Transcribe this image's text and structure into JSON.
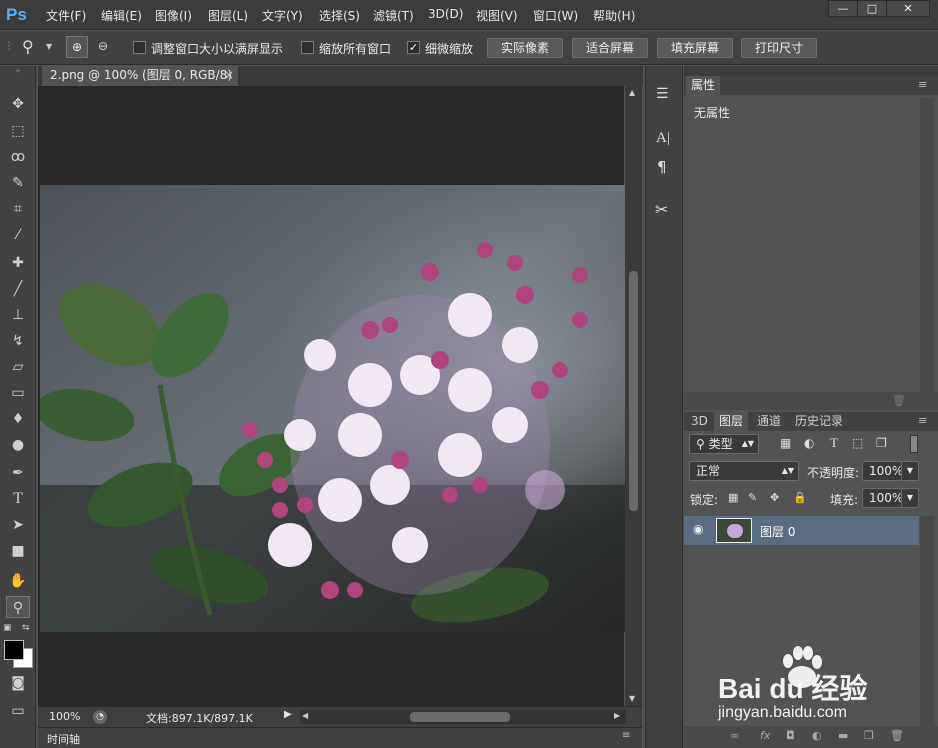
{
  "app": {
    "logo": "Ps"
  },
  "menu": [
    "文件(F)",
    "编辑(E)",
    "图像(I)",
    "图层(L)",
    "文字(Y)",
    "选择(S)",
    "滤镜(T)",
    "3D(D)",
    "视图(V)",
    "窗口(W)",
    "帮助(H)"
  ],
  "window_buttons": {
    "minimize": "—",
    "maximize": "□",
    "close": "✕"
  },
  "options": {
    "resize_windows": "调整窗口大小以满屏显示",
    "zoom_all": "缩放所有窗口",
    "scrubby_zoom": "细微缩放",
    "actual_pixels": "实际像素",
    "fit_screen": "适合屏幕",
    "fill_screen": "填充屏幕",
    "print_size": "打印尺寸"
  },
  "document": {
    "tab_title": "2.png @ 100% (图层 0, RGB/8)",
    "close": "×"
  },
  "status": {
    "zoom": "100%",
    "doc_size": "文档:897.1K/897.1K",
    "timeline_label": "时间轴"
  },
  "properties": {
    "tab": "属性",
    "empty_text": "无属性"
  },
  "layers": {
    "tabs": [
      "3D",
      "图层",
      "通道",
      "历史记录"
    ],
    "filter_kind": "类型",
    "blend_mode": "正常",
    "opacity_label": "不透明度:",
    "opacity_value": "100%",
    "lock_label": "锁定:",
    "fill_label": "填充:",
    "fill_value": "100%",
    "items": [
      {
        "name": "图层 0"
      }
    ]
  },
  "watermark": {
    "text": "Bai du 经验",
    "url": "jingyan.baidu.com"
  },
  "colors": {
    "accent": "#4fb3ff",
    "selected_layer": "#5a6b82",
    "canvas_bg": "#282828"
  }
}
